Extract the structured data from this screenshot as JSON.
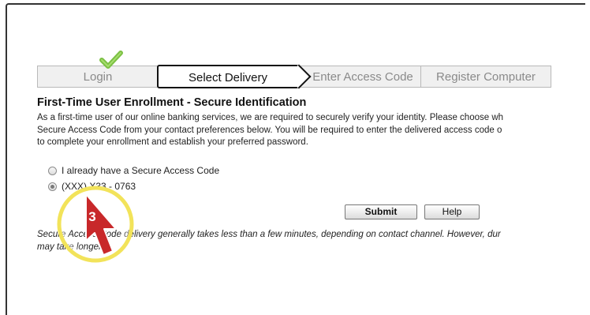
{
  "steps": [
    {
      "label": "Login",
      "state": "complete"
    },
    {
      "label": "Select Delivery",
      "state": "active"
    },
    {
      "label": "Enter Access Code",
      "state": "pending"
    },
    {
      "label": "Register Computer",
      "state": "pending"
    }
  ],
  "title": "First-Time User Enrollment - Secure Identification",
  "intro_lines": [
    "As a first-time user of our online banking services, we are required to securely verify your identity. Please choose wh",
    "Secure Access Code from your contact preferences below. You will be required to enter the delivered access code o",
    "to complete your enrollment and establish your preferred password."
  ],
  "options": [
    {
      "label": "I already have a Secure Access Code",
      "checked": false
    },
    {
      "label": "(XXX) X33 - 0763",
      "checked": true
    }
  ],
  "buttons": {
    "submit": "Submit",
    "help": "Help"
  },
  "footnote_lines": [
    "Secure Access Code delivery generally takes less than a few minutes, depending on contact channel. However, dur",
    "may take longer."
  ],
  "callout": {
    "number": "3"
  },
  "colors": {
    "callout_ring": "#f2e35a",
    "callout_arrow": "#c8282a",
    "check": "#7bc043"
  }
}
